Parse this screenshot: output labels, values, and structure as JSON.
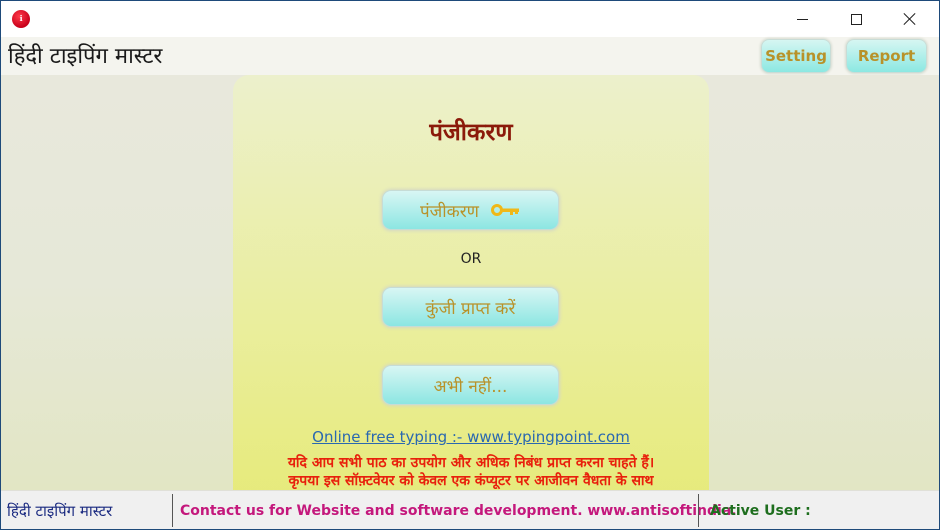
{
  "window": {
    "app_icon": "app-logo-icon",
    "app_icon_glyph": "ℹ",
    "controls": {
      "minimize": "minimize-icon",
      "maximize": "maximize-icon",
      "close": "close-icon"
    }
  },
  "header": {
    "title": "हिंदी टाइपिंग मास्टर",
    "setting_label": "Setting",
    "report_label": "Report"
  },
  "panel": {
    "title": "पंजीकरण",
    "register_button": "पंजीकरण",
    "register_icon": "key-icon",
    "or_text": "OR",
    "get_key_button": "कुंजी प्राप्त करें",
    "not_now_button": "अभी नहीं...",
    "online_link": "Online free typing :- www.typingpoint.com",
    "warning_line_1": "यदि आप सभी पाठ का उपयोग और अधिक निबंध प्राप्त करना चाहते हैं।",
    "warning_line_2": "कृपया इस सॉफ़्टवेयर को केवल एक कंप्यूटर पर आजीवन वैधता के साथ"
  },
  "statusbar": {
    "app_name": "हिंदी टाइपिंग मास्टर",
    "contact": "Contact us for Website and software development. www.antisoftindia.",
    "active_user": "Active User :"
  },
  "colors": {
    "button_text": "#b8922a",
    "title_text": "#8b1a0a",
    "warning_text": "#e8200c",
    "link_text": "#2a68b0",
    "status_app": "#1a2a80",
    "status_contact": "#c4187c",
    "status_user": "#1e6e1e",
    "key_icon": "#f0b818"
  }
}
